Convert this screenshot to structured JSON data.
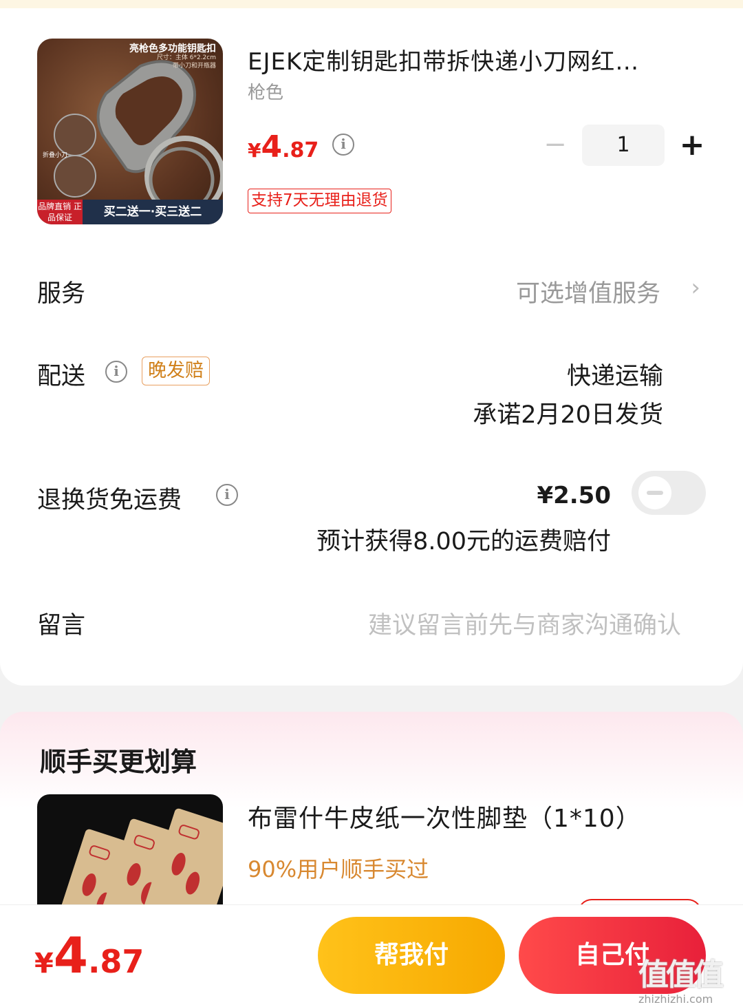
{
  "product": {
    "title": "EJEK定制钥匙扣带拆快递小刀网红…",
    "variant": "枪色",
    "price_currency": "¥",
    "price_int": "4",
    "price_dec": ".87",
    "quantity": "1",
    "minus_symbol": "−",
    "plus_symbol": "+",
    "return_tag": "支持7天无理由退货",
    "image_text": {
      "banner": "亮枪色多功能钥匙扣",
      "size": "尺寸：主体 6*2.2cm",
      "feature": "带小刀和开瓶器",
      "fold_label": "折叠小刀",
      "badge": "品牌直销 正品保证",
      "promo": "买二送一·买三送二"
    }
  },
  "service": {
    "label": "服务",
    "value": "可选增值服务",
    "chevron": "›"
  },
  "delivery": {
    "label": "配送",
    "tag": "晚发赔",
    "method": "快递运输",
    "promise": "承诺2月20日发货"
  },
  "return_freight": {
    "label": "退换货免运费",
    "price": "¥2.50",
    "compensation": "预计获得8.00元的运费赔付",
    "enabled": false
  },
  "message": {
    "label": "留言",
    "placeholder": "建议留言前先与商家沟通确认"
  },
  "info_icon": "i",
  "recommend": {
    "title": "顺手买更划算",
    "item_title": "布雷什牛皮纸一次性脚垫（1*10）",
    "bought_text": "90%用户顺手买过"
  },
  "bottom": {
    "price_currency": "¥",
    "price_int": "4",
    "price_dec": ".87",
    "help_pay": "帮我付",
    "self_pay": "自己付"
  },
  "watermark": {
    "logo": "值值值",
    "url": "zhizhizhi.com"
  },
  "colors": {
    "accent_red": "#e8201a",
    "accent_yellow": "#ffc21a",
    "tag_orange": "#d0801a"
  }
}
